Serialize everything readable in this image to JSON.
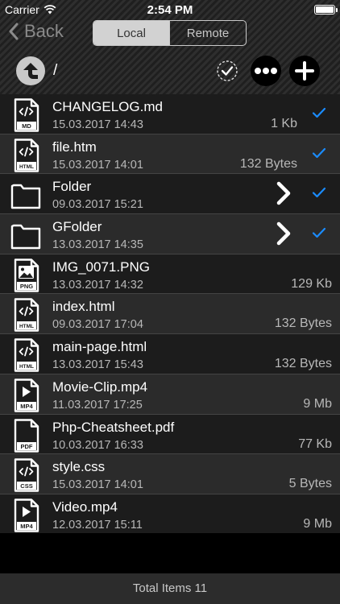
{
  "status_bar": {
    "carrier": "Carrier",
    "time": "2:54 PM",
    "battery_level": 1.0
  },
  "nav": {
    "back_label": "Back",
    "segments": [
      {
        "label": "Local",
        "selected": true
      },
      {
        "label": "Remote",
        "selected": false
      }
    ]
  },
  "toolbar": {
    "path": "/"
  },
  "files": [
    {
      "name": "CHANGELOG.md",
      "date": "15.03.2017 14:43",
      "size": "1 Kb",
      "icon_label": "MD",
      "icon": "code-file-icon",
      "checked": true
    },
    {
      "name": "file.htm",
      "date": "15.03.2017 14:01",
      "size": "132 Bytes",
      "icon_label": "HTML",
      "icon": "code-file-icon",
      "checked": true
    },
    {
      "name": "Folder",
      "date": "09.03.2017 15:21",
      "size": "",
      "icon_label": "",
      "icon": "folder-icon",
      "checked": true,
      "is_folder": true
    },
    {
      "name": "GFolder",
      "date": "13.03.2017 14:35",
      "size": "",
      "icon_label": "",
      "icon": "folder-icon",
      "checked": true,
      "is_folder": true
    },
    {
      "name": "IMG_0071.PNG",
      "date": "13.03.2017 14:32",
      "size": "129 Kb",
      "icon_label": "PNG",
      "icon": "image-file-icon",
      "checked": false
    },
    {
      "name": "index.html",
      "date": "09.03.2017 17:04",
      "size": "132 Bytes",
      "icon_label": "HTML",
      "icon": "code-file-icon",
      "checked": false
    },
    {
      "name": "main-page.html",
      "date": "13.03.2017 15:43",
      "size": "132 Bytes",
      "icon_label": "HTML",
      "icon": "code-file-icon",
      "checked": false
    },
    {
      "name": "Movie-Clip.mp4",
      "date": "11.03.2017 17:25",
      "size": "9 Mb",
      "icon_label": "MP4",
      "icon": "video-file-icon",
      "checked": false
    },
    {
      "name": "Php-Cheatsheet.pdf",
      "date": "10.03.2017 16:33",
      "size": "77 Kb",
      "icon_label": "PDF",
      "icon": "document-file-icon",
      "checked": false
    },
    {
      "name": "style.css",
      "date": "15.03.2017 14:01",
      "size": "5 Bytes",
      "icon_label": "CSS",
      "icon": "code-file-icon",
      "checked": false
    },
    {
      "name": "Video.mp4",
      "date": "12.03.2017 15:11",
      "size": "9 Mb",
      "icon_label": "MP4",
      "icon": "video-file-icon",
      "checked": false
    }
  ],
  "footer": {
    "total_label": "Total Items 11"
  },
  "colors": {
    "accent": "#1a8cff",
    "segment_active": "#d2d2d2"
  }
}
